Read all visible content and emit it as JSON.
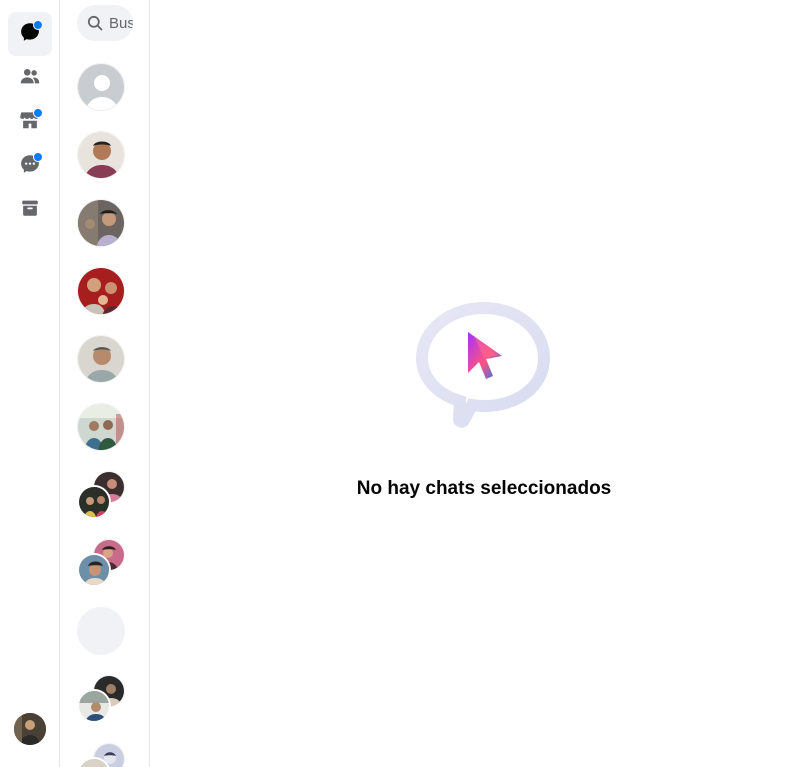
{
  "nav": {
    "items": [
      {
        "icon": "chats-icon",
        "active": true,
        "badge": true
      },
      {
        "icon": "people-icon",
        "active": false,
        "badge": false
      },
      {
        "icon": "marketplace-icon",
        "active": false,
        "badge": true
      },
      {
        "icon": "message-requests-icon",
        "active": false,
        "badge": true
      },
      {
        "icon": "archive-icon",
        "active": false,
        "badge": false
      }
    ],
    "accent_color": "#0a7cff"
  },
  "search": {
    "placeholder": "Buscar en Messenger"
  },
  "chat_list": {
    "items": [
      {
        "type": "single",
        "avatar": "default-avatar"
      },
      {
        "type": "single",
        "avatar": "photo"
      },
      {
        "type": "single",
        "avatar": "photo"
      },
      {
        "type": "single",
        "avatar": "photo"
      },
      {
        "type": "single",
        "avatar": "photo"
      },
      {
        "type": "single",
        "avatar": "photo"
      },
      {
        "type": "group",
        "avatar": "photo"
      },
      {
        "type": "group",
        "avatar": "photo"
      },
      {
        "type": "single",
        "avatar": "placeholder"
      },
      {
        "type": "group",
        "avatar": "photo"
      },
      {
        "type": "group",
        "avatar": "photo"
      }
    ]
  },
  "main": {
    "empty_state_text": "No hay chats seleccionados"
  }
}
